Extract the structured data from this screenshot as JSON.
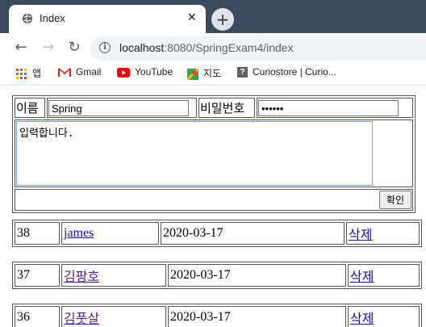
{
  "browser": {
    "tab_title": "Index",
    "url_host": "localhost",
    "url_rest": ":8080/SpringExam4/index",
    "bookmarks": [
      "앱",
      "Gmail",
      "YouTube",
      "지도",
      "Curiostore | Curio..."
    ]
  },
  "form": {
    "name_label": "이름",
    "name_value": "Spring",
    "password_label": "비밀번호",
    "password_value": "••••••",
    "content_value": "입력합니다.",
    "submit_label": "확인"
  },
  "rows": [
    {
      "id": "38",
      "name": "james",
      "date": "2020-03-17",
      "delete": "삭제"
    },
    {
      "id": "37",
      "name": "김팡호",
      "date": "2020-03-17",
      "delete": "삭제"
    },
    {
      "id": "36",
      "name": "김풋살",
      "date": "2020-03-17",
      "delete": "삭제"
    }
  ]
}
